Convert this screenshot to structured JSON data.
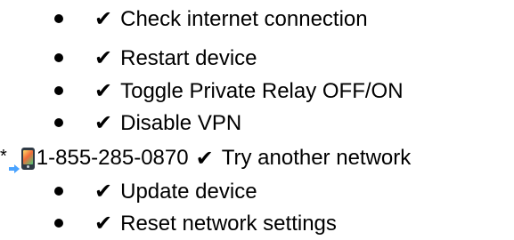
{
  "items_before": [
    {
      "check": "✔",
      "text": "Check internet connection"
    },
    {
      "check": "✔",
      "text": "Restart device"
    },
    {
      "check": "✔",
      "text": "Toggle Private Relay OFF/ON"
    },
    {
      "check": "✔",
      "text": "Disable VPN"
    }
  ],
  "phone_line": {
    "asterisk": "*",
    "arrow_icon": "arrow-right-icon",
    "phone_icon": "mobile-phone-icon",
    "number": "1-855-285-0870",
    "check": "✔",
    "text": "Try another network"
  },
  "items_after": [
    {
      "check": "✔",
      "text": "Update device"
    },
    {
      "check": "✔",
      "text": "Reset network settings"
    }
  ],
  "colors": {
    "text": "#000000",
    "background": "#ffffff"
  }
}
